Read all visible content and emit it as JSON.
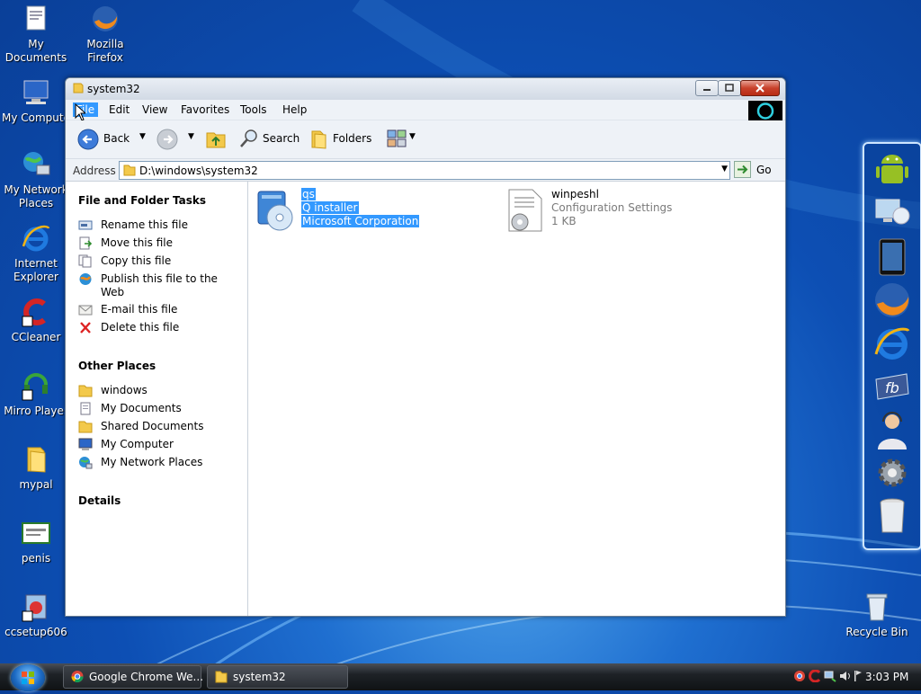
{
  "desktop": {
    "icons": [
      {
        "label": "My\nDocuments",
        "icon": "my-documents-icon"
      },
      {
        "label": "Mozilla\nFirefox",
        "icon": "firefox-icon"
      },
      {
        "label": "My Compute",
        "icon": "my-computer-icon"
      },
      {
        "label": "My Network\nPlaces",
        "icon": "network-places-icon"
      },
      {
        "label": "Internet\nExplorer",
        "icon": "internet-explorer-icon"
      },
      {
        "label": "CCleaner",
        "icon": "ccleaner-icon"
      },
      {
        "label": "Mirro Player",
        "icon": "mirro-player-icon"
      },
      {
        "label": "mypal",
        "icon": "folder-icon"
      },
      {
        "label": "penis",
        "icon": "certificate-icon"
      },
      {
        "label": "ccsetup606",
        "icon": "ccsetup-icon"
      },
      {
        "label": "Recycle Bin",
        "icon": "recycle-bin-icon"
      }
    ]
  },
  "window": {
    "title": "system32",
    "menu": [
      "File",
      "Edit",
      "View",
      "Favorites",
      "Tools",
      "Help"
    ],
    "active_menu": "File",
    "toolbar": {
      "back": "Back",
      "search": "Search",
      "folders": "Folders"
    },
    "address": {
      "label": "Address",
      "value": "D:\\windows\\system32",
      "go": "Go"
    },
    "left_panel": {
      "tasks_title": "File and Folder Tasks",
      "tasks": [
        {
          "label": "Rename this file",
          "icon": "rename-icon"
        },
        {
          "label": "Move this file",
          "icon": "move-icon"
        },
        {
          "label": "Copy this file",
          "icon": "copy-icon"
        },
        {
          "label": "Publish this file to the Web",
          "icon": "publish-web-icon"
        },
        {
          "label": "E-mail this file",
          "icon": "email-icon"
        },
        {
          "label": "Delete this file",
          "icon": "delete-icon"
        }
      ],
      "other_title": "Other Places",
      "other": [
        {
          "label": "windows",
          "icon": "folder-icon"
        },
        {
          "label": "My Documents",
          "icon": "my-documents-icon"
        },
        {
          "label": "Shared Documents",
          "icon": "folder-icon"
        },
        {
          "label": "My Computer",
          "icon": "my-computer-icon"
        },
        {
          "label": "My Network Places",
          "icon": "network-places-icon"
        }
      ],
      "details_title": "Details"
    },
    "files": [
      {
        "name": "qs",
        "line2": "Q installer",
        "line3": "Microsoft Corporation",
        "selected": true,
        "icon": "installer-icon"
      },
      {
        "name": "winpeshl",
        "line2": "Configuration Settings",
        "line3": "1 KB",
        "selected": false,
        "icon": "config-settings-icon"
      }
    ]
  },
  "taskbar": {
    "buttons": [
      {
        "label": "Google Chrome We...",
        "icon": "chrome-icon"
      },
      {
        "label": "system32",
        "icon": "folder-icon"
      }
    ],
    "clock": "3:03 PM"
  },
  "colors": {
    "selection": "#3399ff",
    "desktop": "#0d4fb4"
  }
}
